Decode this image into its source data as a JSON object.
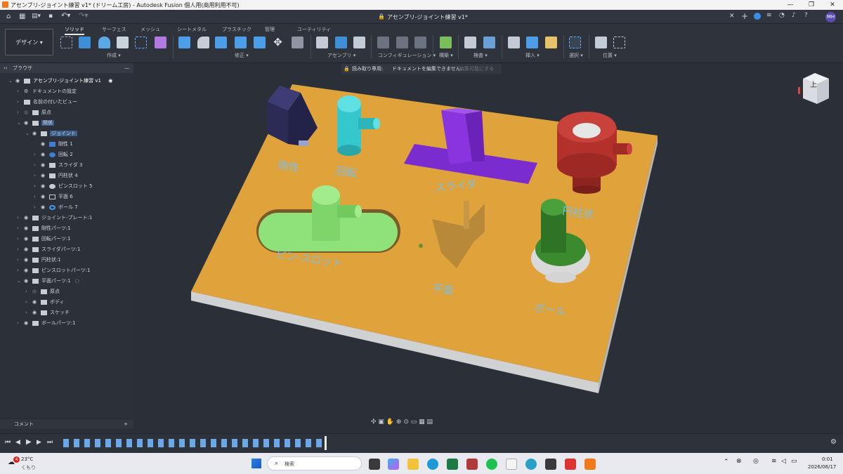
{
  "window": {
    "title": "アセンブリ-ジョイント練習 v1* (ドリーム工房) - Autodesk Fusion 個人用(商用利用不可)",
    "doc_tab": "アセンブリ-ジョイント練習 v1*",
    "user_initials": "MH"
  },
  "toolbar": {
    "workspace": "デザイン ▾",
    "tabs": [
      "ソリッド",
      "サーフェス",
      "メッシュ",
      "シートメタル",
      "プラスチック",
      "管理",
      "ユーティリティ"
    ],
    "groups": [
      "作成 ▾",
      "修正 ▾",
      "アセンブリ ▾",
      "コンフィギュレーション ▾",
      "構築 ▾",
      "検査 ▾",
      "挿入 ▾",
      "選択 ▾",
      "位置 ▾"
    ]
  },
  "notice": {
    "text": "読み取り専用:",
    "detail": "ドキュメントを編集できません",
    "action": "編集可能にする"
  },
  "browser": {
    "header": "ブラウザ",
    "collapse": "‹‹",
    "minimize": "—",
    "root": "アセンブリ-ジョイント練習 v1",
    "items": [
      {
        "label": "ドキュメントの設定"
      },
      {
        "label": "名前の付いたビュー"
      },
      {
        "label": "原点"
      },
      {
        "label": "関係"
      },
      {
        "label": "ジョイント"
      },
      {
        "label": "剛性 1"
      },
      {
        "label": "回転 2"
      },
      {
        "label": "スライダ 3"
      },
      {
        "label": "円柱状 4"
      },
      {
        "label": "ピンスロット 5"
      },
      {
        "label": "平面 6"
      },
      {
        "label": "ボール 7"
      },
      {
        "label": "ジョイント-プレート:1"
      },
      {
        "label": "剛性パーツ:1"
      },
      {
        "label": "回転パーツ:1"
      },
      {
        "label": "スライダパーツ:1"
      },
      {
        "label": "円柱状:1"
      },
      {
        "label": "ピンスロットパーツ:1"
      },
      {
        "label": "平面パーツ:1"
      },
      {
        "label": "原点"
      },
      {
        "label": "ボディ"
      },
      {
        "label": "スケッチ"
      },
      {
        "label": "ボールパーツ:1"
      }
    ]
  },
  "comment": {
    "label": "コメント",
    "add": "+"
  },
  "viewcube": {
    "label": "上"
  },
  "model_labels": [
    "剛性",
    "回転",
    "スライダ",
    "円柱状",
    "ピン-スロット",
    "平面",
    "ボール"
  ],
  "taskbar": {
    "temp": "23°C",
    "weather": "くもり",
    "badge": "4",
    "search": "検索",
    "time": "0:01",
    "date": "2026/06/17"
  },
  "colors": {
    "plate": "#e0a33c",
    "rigid": "#2e2e5e",
    "revolute": "#34c8cc",
    "slider": "#7a2ccf",
    "cylindrical": "#b4302a",
    "pinslot": "#8fe27a",
    "ball": "#3b8a2e"
  }
}
